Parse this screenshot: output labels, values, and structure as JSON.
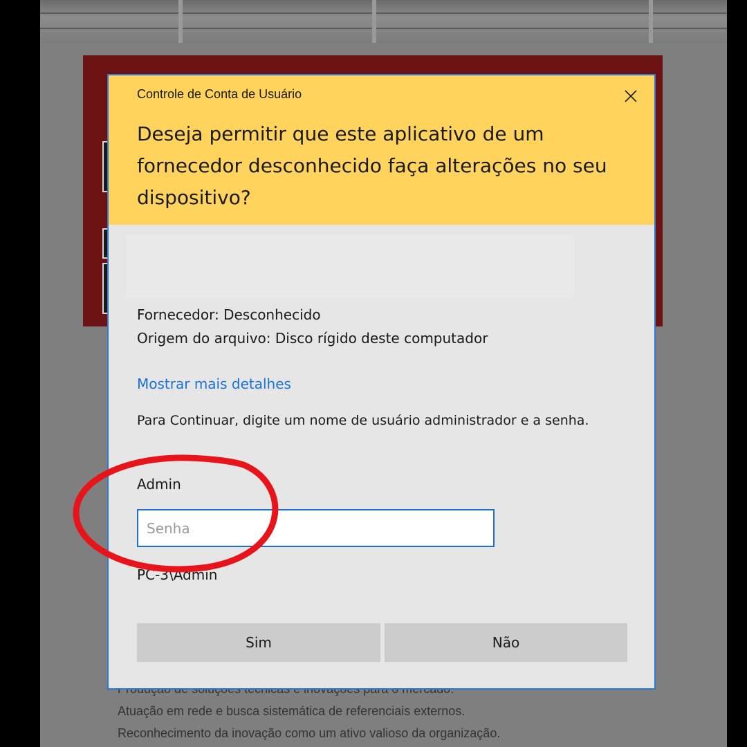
{
  "background_page": {
    "lines": [
      "Produção de soluções técnicas e inovações para o mercado.",
      "Atuação em rede e busca sistemática de referenciais externos.",
      "Reconhecimento da inovação como um ativo valioso da organização."
    ]
  },
  "dialog": {
    "caption": "Controle de Conta de Usuário",
    "question": "Deseja permitir que este aplicativo de um fornecedor desconhecido faça alterações no seu dispositivo?",
    "publisher": "Fornecedor: Desconhecido",
    "file_origin": "Origem do arquivo: Disco rígido deste computador",
    "details_link": "Mostrar mais detalhes",
    "instructions": "Para Continuar, digite um nome de usuário administrador e a senha.",
    "username": "Admin",
    "password_placeholder": "Senha",
    "password_value": "",
    "domain_user": "PC-3\\Admin",
    "yes_label": "Sim",
    "no_label": "Não"
  },
  "colors": {
    "header": "#ffd35c",
    "body": "#e6e6e6",
    "link": "#1a73d2",
    "input_border": "#1f6fd1",
    "button": "#cccccc",
    "annotation": "#e8141b"
  },
  "icons": {
    "close": "close-icon"
  }
}
